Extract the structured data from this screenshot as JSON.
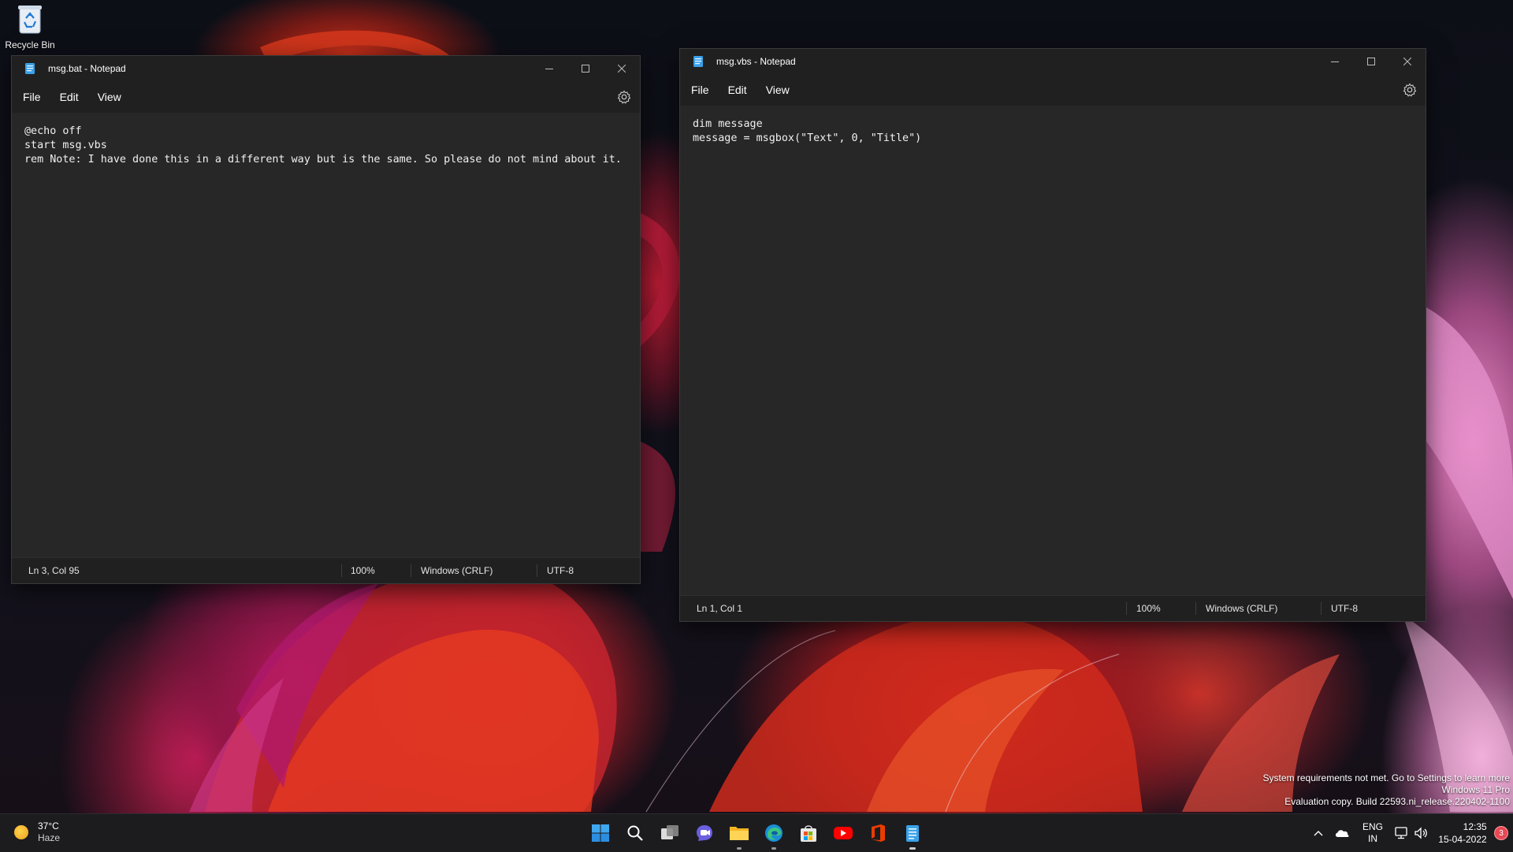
{
  "desktop": {
    "recycle_bin_label": "Recycle Bin"
  },
  "windows": [
    {
      "title": "msg.bat - Notepad",
      "menu": [
        "File",
        "Edit",
        "View"
      ],
      "lines": [
        "@echo off",
        "start msg.vbs",
        "rem Note: I have done this in a different way but is the same. So please do not mind about it."
      ],
      "status": {
        "position": "Ln 3, Col 95",
        "zoom": "100%",
        "line_ending": "Windows (CRLF)",
        "encoding": "UTF-8"
      }
    },
    {
      "title": "msg.vbs - Notepad",
      "menu": [
        "File",
        "Edit",
        "View"
      ],
      "lines": [
        "dim message",
        "message = msgbox(\"Text\", 0, \"Title\")"
      ],
      "status": {
        "position": "Ln 1, Col 1",
        "zoom": "100%",
        "line_ending": "Windows (CRLF)",
        "encoding": "UTF-8"
      }
    }
  ],
  "watermark": {
    "line1": "System requirements not met. Go to Settings to learn more",
    "line2": "Windows 11 Pro",
    "line3": "Evaluation copy. Build 22593.ni_release.220402-1100"
  },
  "taskbar": {
    "weather": {
      "temp": "37°C",
      "condition": "Haze"
    },
    "apps": [
      "start-icon",
      "search-icon",
      "task-view-icon",
      "teams-chat-icon",
      "file-explorer-icon",
      "edge-icon",
      "store-icon",
      "youtube-icon",
      "office-icon",
      "notepad-icon"
    ],
    "language": {
      "line1": "ENG",
      "line2": "IN"
    },
    "clock": {
      "time": "12:35",
      "date": "15-04-2022"
    },
    "notification_count": "3"
  },
  "colors": {
    "window_bg": "#272727",
    "titlebar_bg": "#202020",
    "taskbar_bg": "#1c1c1f",
    "badge": "#e74856"
  }
}
